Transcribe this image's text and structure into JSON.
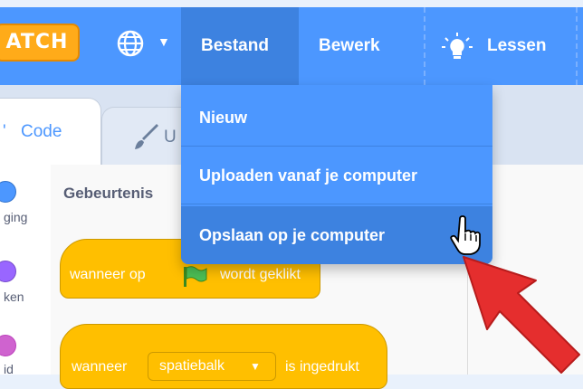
{
  "menubar": {
    "logo_text": "ATCH",
    "globe_icon": "globe-icon",
    "items": [
      {
        "label": "Bestand"
      },
      {
        "label": "Bewerk"
      },
      {
        "label": "Lessen"
      }
    ],
    "colors": {
      "bar": "#4c97ff",
      "active": "#3d82e0"
    }
  },
  "file_menu": {
    "items": [
      {
        "label": "Nieuw"
      },
      {
        "label": "Uploaden vanaf je computer"
      },
      {
        "label": "Opslaan op je computer"
      }
    ]
  },
  "tabs": {
    "code": "Code",
    "costumes": "U"
  },
  "categories": {
    "labels": [
      "ging",
      "ken",
      "id"
    ]
  },
  "palette": {
    "title": "Gebeurtenis",
    "blocks": {
      "flag_block": {
        "prefix": "wanneer op",
        "suffix": "wordt geklikt"
      },
      "key_block": {
        "prefix": "wanneer",
        "key": "spatiebalk",
        "suffix": "is ingedrukt"
      }
    },
    "colors": {
      "events": "#ffbf00"
    }
  }
}
